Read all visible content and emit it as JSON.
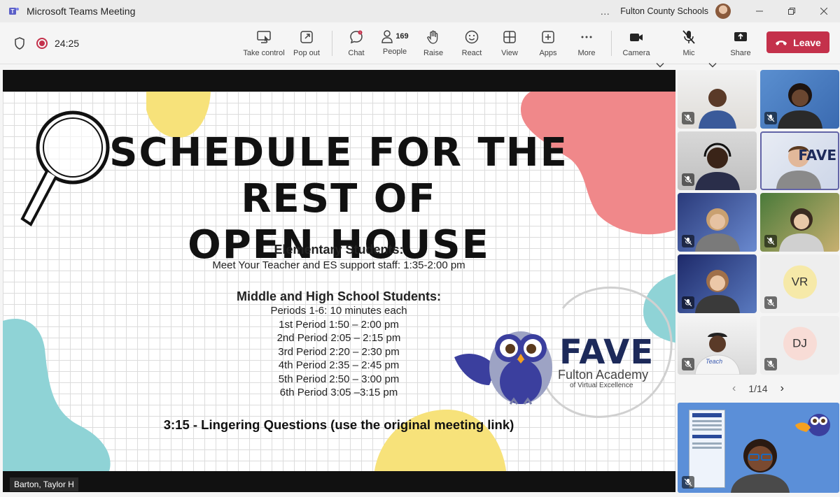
{
  "window": {
    "title": "Microsoft Teams Meeting",
    "more_label": "…",
    "org_name": "Fulton County Schools"
  },
  "toolbar": {
    "timer": "24:25",
    "buttons": {
      "take_control": "Take control",
      "pop_out": "Pop out",
      "chat": "Chat",
      "people": "People",
      "people_count": "169",
      "raise": "Raise",
      "react": "React",
      "view": "View",
      "apps": "Apps",
      "more": "More",
      "camera": "Camera",
      "mic": "Mic",
      "share": "Share"
    },
    "leave_label": "Leave"
  },
  "slide": {
    "title_line1": "Schedule for the rest of",
    "title_line2": "Open House",
    "elementary_heading": "Elementary Students:",
    "elementary_text": "Meet Your Teacher and ES support staff:  1:35-2:00 pm",
    "mhs_heading": "Middle and High School Students:",
    "periods": [
      "Periods 1-6: 10 minutes each",
      "1st Period 1:50 – 2:00 pm",
      "2nd Period 2:05 – 2:15 pm",
      "3rd Period 2:20 – 2:30 pm",
      "4th Period 2:35 – 2:45 pm",
      "5th Period 2:50 – 3:00 pm",
      "6th Period 3:05 –3:15 pm"
    ],
    "lingering": "3:15 - Lingering Questions (use the original meeting link)",
    "logo_name": "FAVE",
    "logo_sub1": "Fulton Academy",
    "logo_sub2": "of Virtual Excellence"
  },
  "presenter_name": "Barton, Taylor H",
  "participants": {
    "initials_vr": "VR",
    "initials_dj": "DJ",
    "tile6_shirt": "Teach"
  },
  "pager": {
    "label": "1/14"
  },
  "colors": {
    "leave": "#c4314b",
    "accent": "#6264a7",
    "blob_pink": "#f0888a",
    "blob_yellow": "#f7e27a",
    "blob_teal": "#8fd3d6"
  }
}
